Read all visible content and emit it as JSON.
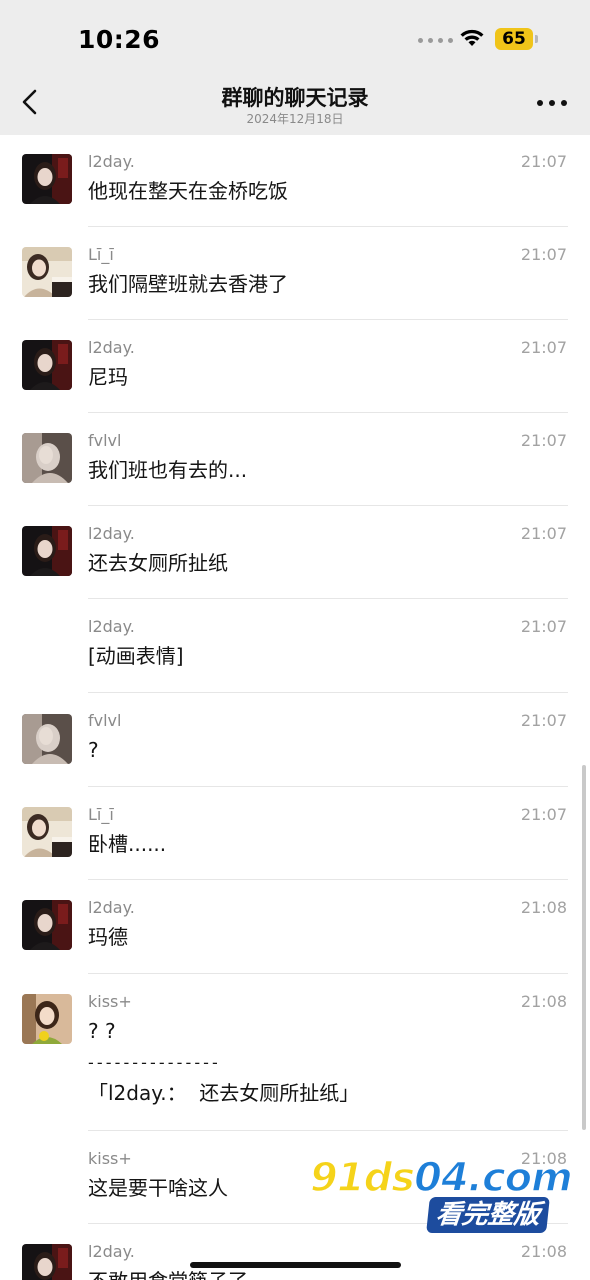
{
  "status_bar": {
    "time": "10:26",
    "battery": "65"
  },
  "colors": {
    "battery": "#f0c419",
    "header_bg": "#ededed",
    "watermark_yellow": "#f5d31a",
    "watermark_blue": "#1e7fd8"
  },
  "nav": {
    "title": "群聊的聊天记录",
    "subtitle": "2024年12月18日",
    "back_icon": "chevron-left-icon",
    "more_icon": "more-dots-icon"
  },
  "messages": [
    {
      "sender": "l2day.",
      "time": "21:07",
      "text": "他现在整天在金桥吃饭",
      "avatar": "avatar-l2day"
    },
    {
      "sender": "Lī_ī",
      "time": "21:07",
      "text": "我们隔壁班就去香港了",
      "avatar": "avatar-li"
    },
    {
      "sender": "l2day.",
      "time": "21:07",
      "text": "尼玛",
      "avatar": "avatar-l2day"
    },
    {
      "sender": "fvlvl",
      "time": "21:07",
      "text": "我们班也有去的...",
      "avatar": "avatar-fvlvl"
    },
    {
      "sender": "l2day.",
      "time": "21:07",
      "text": "还去女厕所扯纸",
      "avatar": "avatar-l2day"
    },
    {
      "sender": "l2day.",
      "time": "21:07",
      "text": "[动画表情]",
      "avatar": ""
    },
    {
      "sender": "fvlvl",
      "time": "21:07",
      "text": "?",
      "avatar": "avatar-fvlvl"
    },
    {
      "sender": "Lī_ī",
      "time": "21:07",
      "text": "卧槽......",
      "avatar": "avatar-li"
    },
    {
      "sender": "l2day.",
      "time": "21:08",
      "text": "玛德",
      "avatar": "avatar-l2day"
    },
    {
      "sender": "kiss+",
      "time": "21:08",
      "text": "? ?",
      "quote_divider": "- - - - - - - - - - - - - - -",
      "quote": "「l2day.：  还去女厕所扯纸」",
      "avatar": "avatar-kiss"
    },
    {
      "sender": "kiss+",
      "time": "21:08",
      "text": "这是要干啥这人",
      "avatar": ""
    },
    {
      "sender": "l2day.",
      "time": "21:08",
      "text": "不敢用食堂筷子了",
      "avatar": "avatar-l2day"
    }
  ],
  "watermark": {
    "domain_part1": "91ds",
    "domain_part2": "04.com",
    "tag": "看完整版"
  }
}
